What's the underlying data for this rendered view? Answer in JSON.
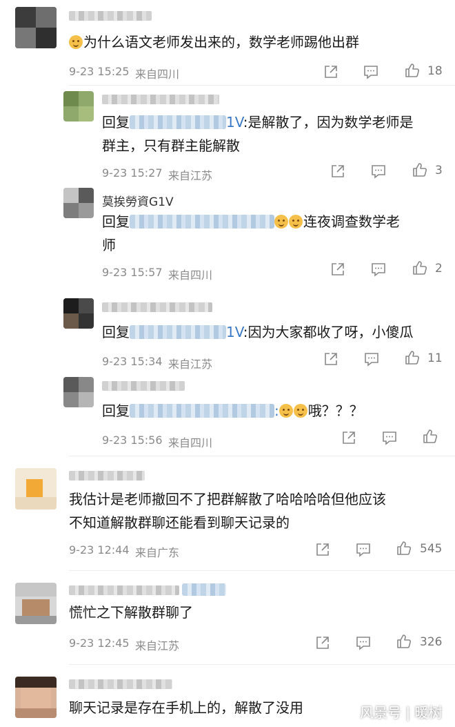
{
  "comments": [
    {
      "name": "",
      "text": "为什么语文老师发出来的，数学老师踢他出群",
      "time": "9-23 15:25",
      "location": "来自四川",
      "likes": "18"
    },
    {
      "name": "",
      "reply_prefix": "回复",
      "mention_suffix": "1V",
      "text": ":是解散了，因为数学老师是\n群主，只有群主能解散",
      "time": "9-23 15:27",
      "location": "来自江苏",
      "likes": "3"
    },
    {
      "name": "莫挨勞資G1V",
      "reply_prefix": "回复",
      "mention_suffix": "",
      "text": "连夜调查数学老\n师",
      "time": "9-23 15:57",
      "location": "来自四川",
      "likes": "2"
    },
    {
      "name": "",
      "reply_prefix": "回复",
      "mention_suffix": "1V",
      "text": ":因为大家都收了呀，小傻瓜",
      "time": "9-23 15:34",
      "location": "来自江苏",
      "likes": "11"
    },
    {
      "name": "",
      "reply_prefix": "回复",
      "mention_suffix": "",
      "text": "哦？？？",
      "time": "9-23 15:56",
      "location": "来自四川",
      "likes": ""
    },
    {
      "name": "",
      "text": "我估计是老师撤回不了把群解散了哈哈哈哈但他应该\n不知道解散群聊还能看到聊天记录的",
      "time": "9-23 12:44",
      "location": "来自广东",
      "likes": "545"
    },
    {
      "name": "",
      "text": "慌忙之下解散群聊了",
      "time": "9-23 12:45",
      "location": "来自江苏",
      "likes": "326"
    },
    {
      "name": "",
      "text": "聊天记录是存在手机上的，解散了没用",
      "time": "",
      "location": "",
      "likes": ""
    }
  ],
  "watermark": "风景号 | 暖树",
  "colors": {
    "mention": "#3a7ac7",
    "meta": "#8a8a8a",
    "text": "#1a1a1a"
  },
  "icons": [
    "share-icon",
    "comment-icon",
    "like-icon"
  ]
}
